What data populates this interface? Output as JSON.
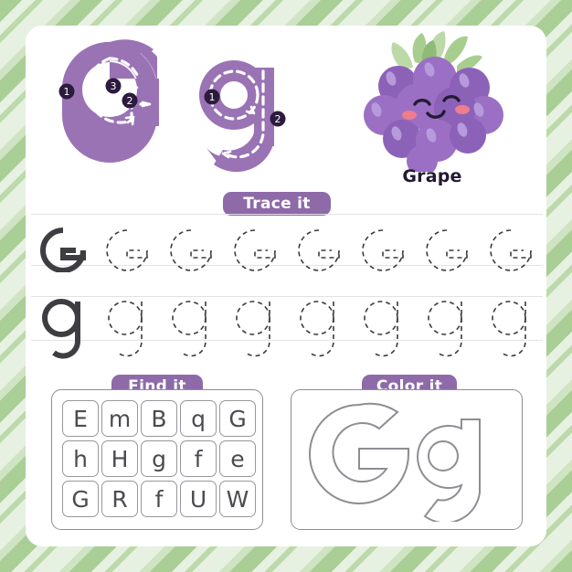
{
  "worksheet": {
    "letter_upper": "G",
    "letter_lower": "g",
    "border_style": "diagonal-green-stripes"
  },
  "colors": {
    "purple": "#8e6aa8",
    "letter_purple": "#9a73b5",
    "grape_body": "#9b6fc4",
    "grape_dark": "#7e57a8",
    "grape_light": "#b69adb",
    "leaf_green": "#a8ce8f",
    "leaf_green_dark": "#8fba77",
    "cheek_pink": "#ef7d8e",
    "face_dark": "#231a33",
    "trace_solid": "#3d3d42",
    "trace_dashed": "#3a3a40",
    "guideline": "#e2e2e6",
    "panel_border": "#8d8d93",
    "cell_border": "#97979c",
    "cell_text": "#4b4b50",
    "stripe_green": "#a9ce96",
    "stripe_pale": "#e7f1e1"
  },
  "top_section": {
    "trace_guide": {
      "upper_steps": [
        "1",
        "2",
        "3"
      ],
      "lower_steps": [
        "1",
        "2"
      ]
    },
    "fruit": {
      "name": "Grape",
      "icon": "grape-cluster-icon"
    }
  },
  "sections": {
    "trace": {
      "label": "Trace it",
      "rows": [
        {
          "case": "uppercase",
          "model": "G",
          "dashed_count": 7,
          "dashed": [
            "G",
            "G",
            "G",
            "G",
            "G",
            "G",
            "G"
          ]
        },
        {
          "case": "lowercase",
          "model": "g",
          "dashed_count": 7,
          "dashed": [
            "g",
            "g",
            "g",
            "g",
            "g",
            "g",
            "g"
          ]
        }
      ]
    },
    "find": {
      "label": "Find it",
      "target": "G",
      "grid_rows": [
        [
          "E",
          "m",
          "B",
          "q",
          "G"
        ],
        [
          "h",
          "H",
          "g",
          "f",
          "e"
        ],
        [
          "G",
          "R",
          "f",
          "U",
          "W"
        ]
      ]
    },
    "color": {
      "label": "Color it",
      "outline_letters": "Gg"
    }
  }
}
